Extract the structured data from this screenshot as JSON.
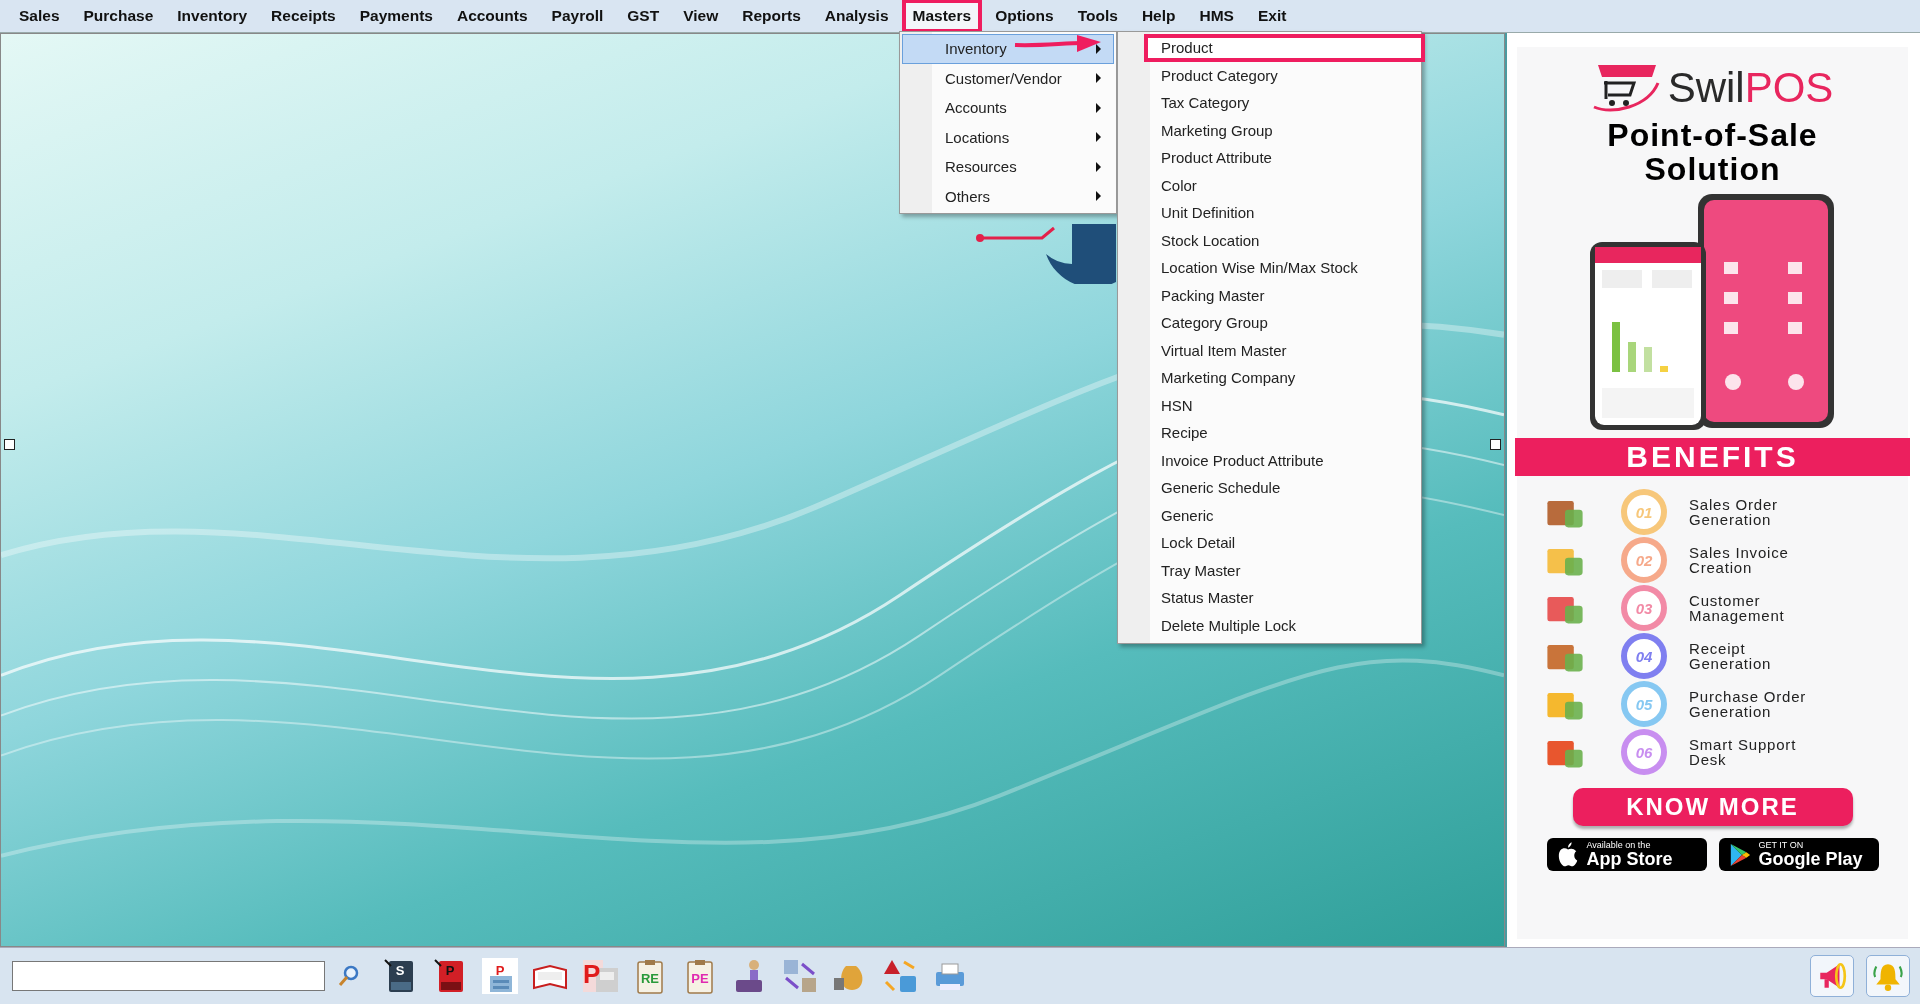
{
  "menu_bar": [
    {
      "label": "Sales",
      "selected": false
    },
    {
      "label": "Purchase",
      "selected": false
    },
    {
      "label": "Inventory",
      "selected": false
    },
    {
      "label": "Receipts",
      "selected": false
    },
    {
      "label": "Payments",
      "selected": false
    },
    {
      "label": "Accounts",
      "selected": false
    },
    {
      "label": "Payroll",
      "selected": false
    },
    {
      "label": "GST",
      "selected": false
    },
    {
      "label": "View",
      "selected": false
    },
    {
      "label": "Reports",
      "selected": false
    },
    {
      "label": "Analysis",
      "selected": false
    },
    {
      "label": "Masters",
      "selected": true
    },
    {
      "label": "Options",
      "selected": false
    },
    {
      "label": "Tools",
      "selected": false
    },
    {
      "label": "Help",
      "selected": false
    },
    {
      "label": "HMS",
      "selected": false
    },
    {
      "label": "Exit",
      "selected": false
    }
  ],
  "masters_menu": [
    {
      "label": "Inventory",
      "selected": true
    },
    {
      "label": "Customer/Vendor",
      "selected": false
    },
    {
      "label": "Accounts",
      "selected": false
    },
    {
      "label": "Locations",
      "selected": false
    },
    {
      "label": "Resources",
      "selected": false
    },
    {
      "label": "Others",
      "selected": false
    }
  ],
  "inventory_submenu": [
    {
      "label": "Product",
      "highlighted": true
    },
    {
      "label": "Product Category",
      "highlighted": false
    },
    {
      "label": "Tax Category",
      "highlighted": false
    },
    {
      "label": "Marketing Group",
      "highlighted": false
    },
    {
      "label": "Product Attribute",
      "highlighted": false
    },
    {
      "label": "Color",
      "highlighted": false
    },
    {
      "label": "Unit Definition",
      "highlighted": false
    },
    {
      "label": "Stock Location",
      "highlighted": false
    },
    {
      "label": "Location Wise Min/Max Stock",
      "highlighted": false
    },
    {
      "label": "Packing Master",
      "highlighted": false
    },
    {
      "label": "Category Group",
      "highlighted": false
    },
    {
      "label": "Virtual Item Master",
      "highlighted": false
    },
    {
      "label": "Marketing Company",
      "highlighted": false
    },
    {
      "label": "HSN",
      "highlighted": false
    },
    {
      "label": "Recipe",
      "highlighted": false
    },
    {
      "label": "Invoice Product Attribute",
      "highlighted": false
    },
    {
      "label": "Generic Schedule",
      "highlighted": false
    },
    {
      "label": "Generic",
      "highlighted": false
    },
    {
      "label": "Lock Detail",
      "highlighted": false
    },
    {
      "label": "Tray Master",
      "highlighted": false
    },
    {
      "label": "Status Master",
      "highlighted": false
    },
    {
      "label": "Delete Multiple Lock",
      "highlighted": false
    }
  ],
  "ad": {
    "logo": {
      "dark": "Swil",
      "accent": "POS"
    },
    "headline": "Point-of-Sale Solution",
    "benefits_title": "BENEFITS",
    "benefits": [
      {
        "number": "01",
        "text": "Sales Order Generation",
        "color": "#f7c77a"
      },
      {
        "number": "02",
        "text": "Sales Invoice Creation",
        "color": "#f6a98a"
      },
      {
        "number": "03",
        "text": "Customer Management",
        "color": "#f28aa6"
      },
      {
        "number": "04",
        "text": "Receipt Generation",
        "color": "#7f7ff0"
      },
      {
        "number": "05",
        "text": "Purchase Order Generation",
        "color": "#86c8f2"
      },
      {
        "number": "06",
        "text": "Smart Support Desk",
        "color": "#c88ef0"
      }
    ],
    "cta": "KNOW MORE",
    "stores": [
      {
        "kind": "apple",
        "small": "Available on the",
        "big": "App Store"
      },
      {
        "kind": "google",
        "small": "GET IT ON",
        "big": "Google Play"
      }
    ]
  },
  "toolbar": [
    {
      "kind": "book",
      "glyph": "S"
    },
    {
      "kind": "ledger",
      "glyph": "P"
    },
    {
      "kind": "cabinet",
      "glyph": "P"
    },
    {
      "kind": "order-book"
    },
    {
      "kind": "documents",
      "glyph": "P"
    },
    {
      "kind": "receipt-clipboard",
      "glyph": "RE"
    },
    {
      "kind": "payment-clipboard",
      "glyph": "PE"
    },
    {
      "kind": "person"
    },
    {
      "kind": "transfer"
    },
    {
      "kind": "money-bag"
    },
    {
      "kind": "shapes"
    },
    {
      "kind": "printer"
    }
  ],
  "tray": [
    {
      "kind": "megaphone"
    },
    {
      "kind": "bell"
    }
  ]
}
